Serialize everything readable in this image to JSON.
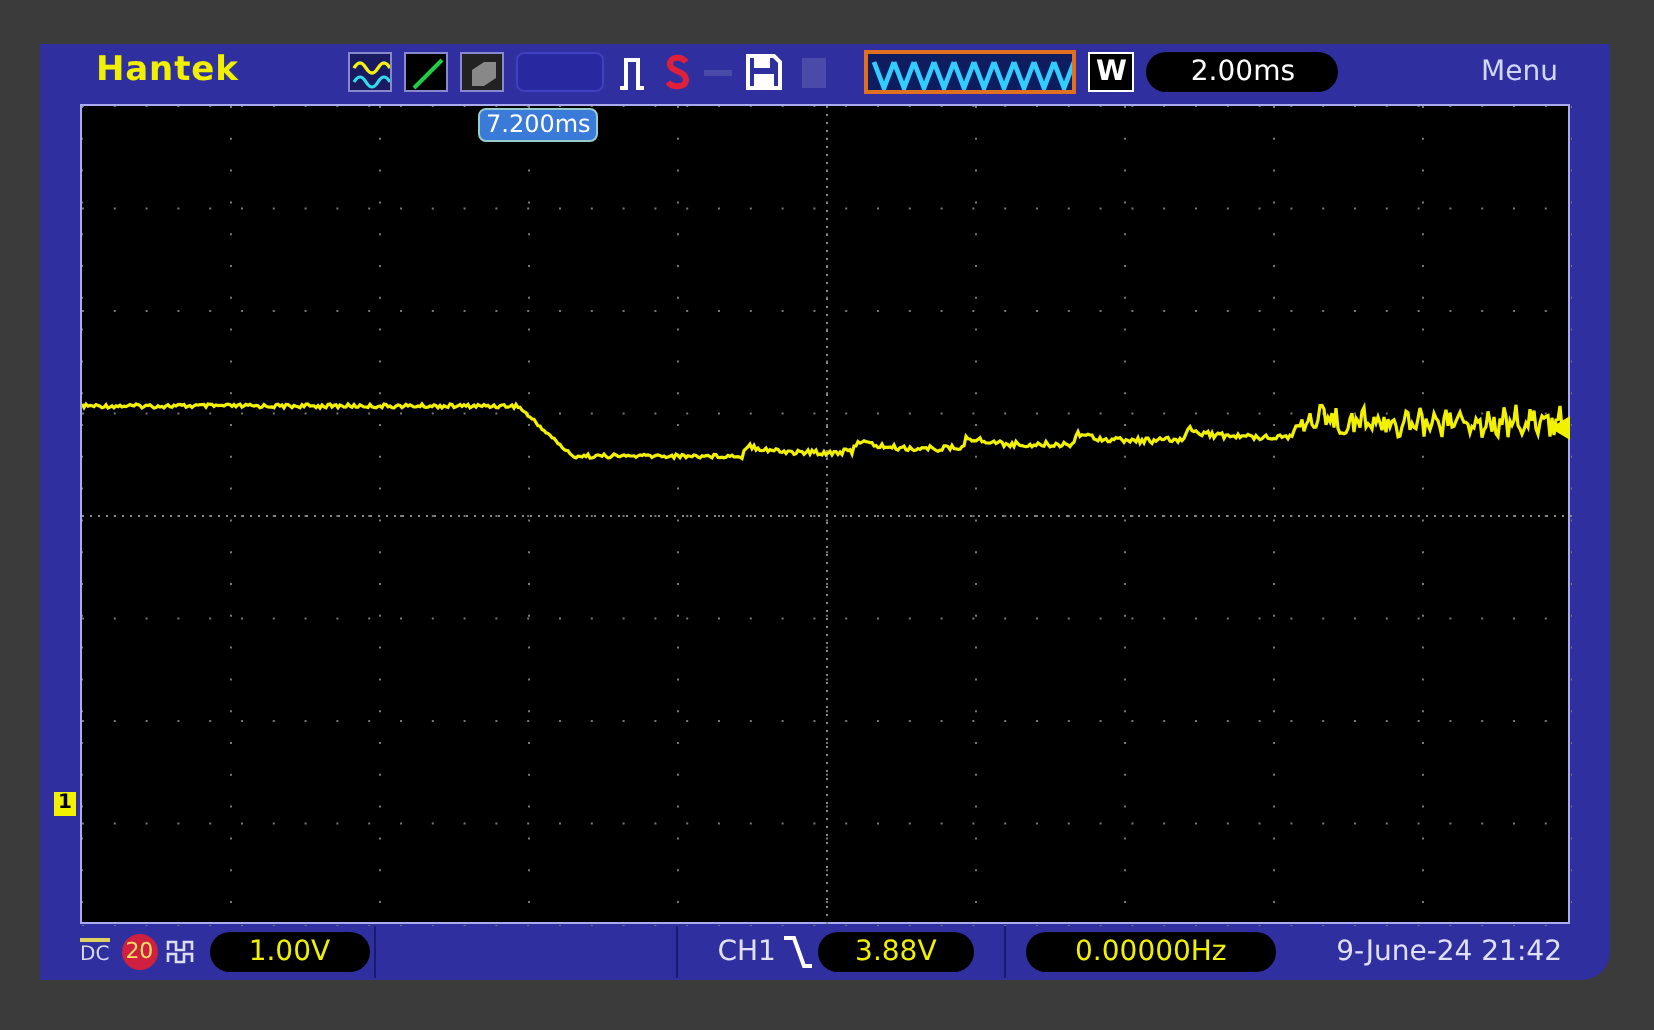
{
  "brand": "Hantek",
  "top_bar": {
    "trigger_position": "7.200ms",
    "timebase_mode": "W",
    "timebase": "2.00ms",
    "menu": "Menu"
  },
  "channel_marker": "1",
  "bottom_bar": {
    "coupling": "DC",
    "bandwidth_limit": "20",
    "volts_per_div": "1.00V",
    "trigger_source": "CH1",
    "trigger_level": "3.88V",
    "frequency": "0.00000Hz",
    "datetime": "9-June-24 21:42"
  }
}
